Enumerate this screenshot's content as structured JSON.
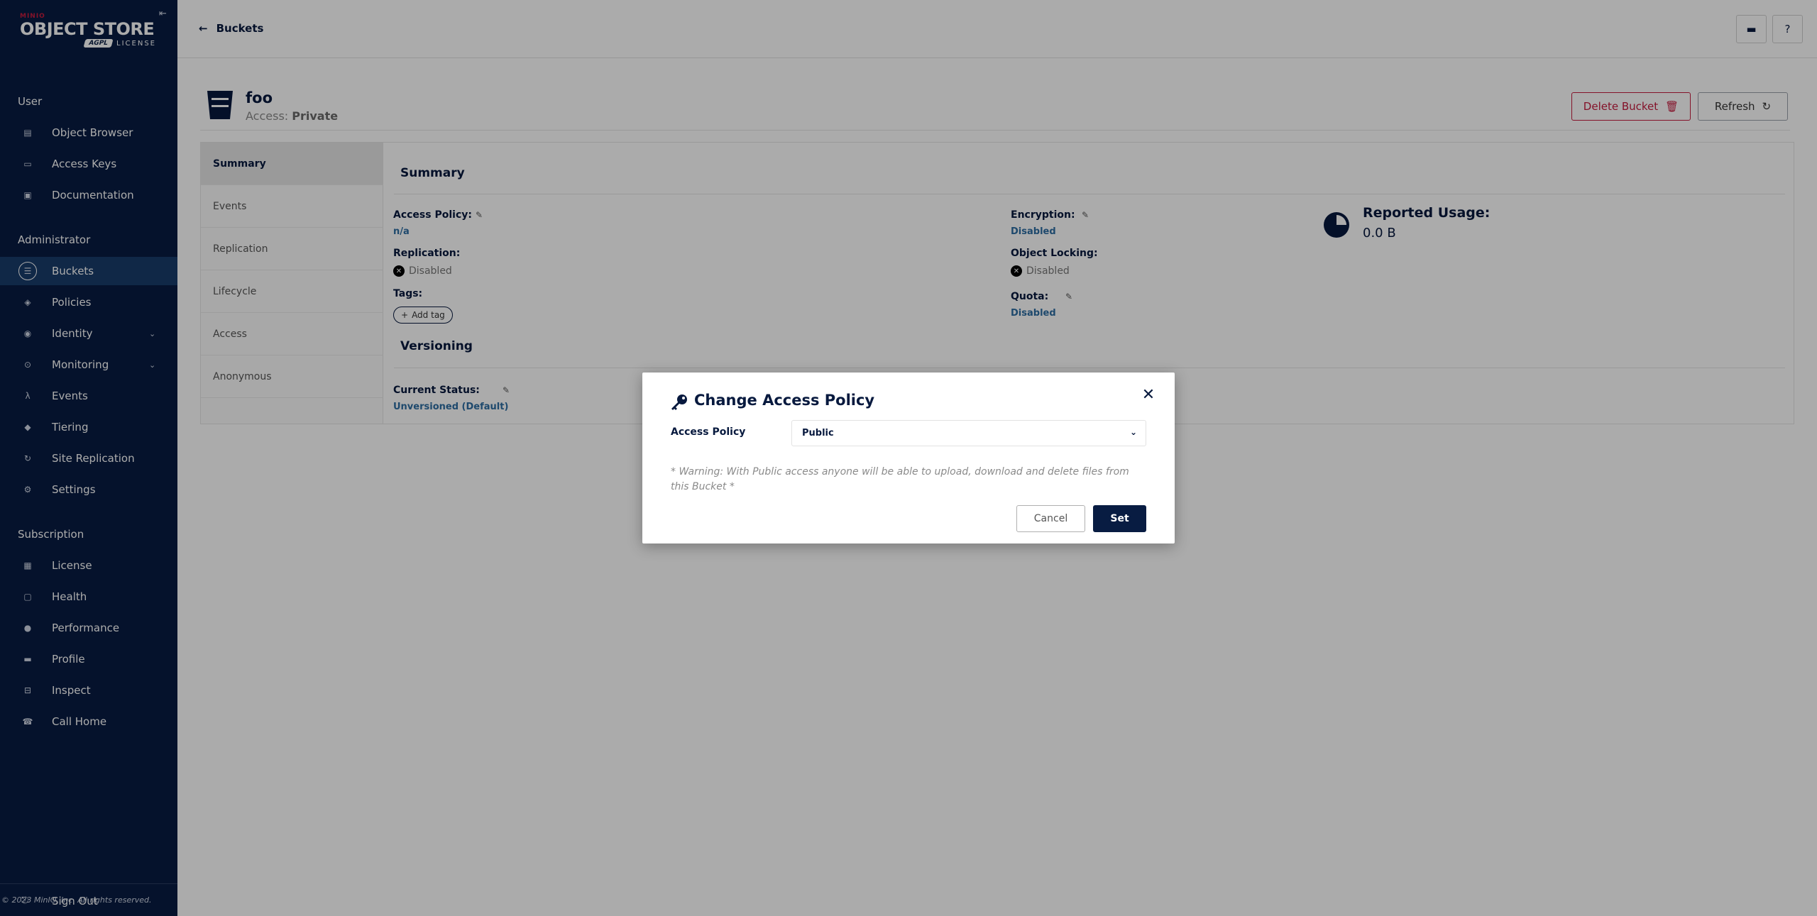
{
  "sidebar": {
    "logo": {
      "brand": "MINIO",
      "product": "OBJECT STORE",
      "badge": "AGPL",
      "license": "LICENSE"
    },
    "sections": {
      "user": "User",
      "administrator": "Administrator",
      "subscription": "Subscription"
    },
    "user_items": [
      {
        "label": "Object Browser",
        "icon": "object-browser-icon"
      },
      {
        "label": "Access Keys",
        "icon": "access-keys-icon"
      },
      {
        "label": "Documentation",
        "icon": "documentation-icon"
      }
    ],
    "admin_items": [
      {
        "label": "Buckets",
        "icon": "buckets-icon",
        "active": true
      },
      {
        "label": "Policies",
        "icon": "policies-icon"
      },
      {
        "label": "Identity",
        "icon": "identity-icon",
        "expandable": true
      },
      {
        "label": "Monitoring",
        "icon": "monitoring-icon",
        "expandable": true
      },
      {
        "label": "Events",
        "icon": "lambda-icon"
      },
      {
        "label": "Tiering",
        "icon": "tiering-icon"
      },
      {
        "label": "Site Replication",
        "icon": "site-replication-icon"
      },
      {
        "label": "Settings",
        "icon": "gear-icon"
      }
    ],
    "subscription_items": [
      {
        "label": "License",
        "icon": "license-icon"
      },
      {
        "label": "Health",
        "icon": "health-icon"
      },
      {
        "label": "Performance",
        "icon": "performance-icon"
      },
      {
        "label": "Profile",
        "icon": "profile-icon"
      },
      {
        "label": "Inspect",
        "icon": "inspect-icon"
      },
      {
        "label": "Call Home",
        "icon": "phone-icon"
      }
    ],
    "sign_out": "Sign Out",
    "copyright": "© 2023 MinIO, Inc. All rights reserved."
  },
  "topbar": {
    "back_label": "Buckets"
  },
  "bucket": {
    "name": "foo",
    "access_prefix": "Access:",
    "access_value": "Private",
    "delete_label": "Delete Bucket",
    "refresh_label": "Refresh"
  },
  "tabs": [
    "Summary",
    "Events",
    "Replication",
    "Lifecycle",
    "Access",
    "Anonymous"
  ],
  "summary": {
    "title": "Summary",
    "access_policy_label": "Access Policy:",
    "access_policy_value": "n/a",
    "replication_label": "Replication:",
    "replication_value": "Disabled",
    "tags_label": "Tags:",
    "add_tag_label": "Add tag",
    "encryption_label": "Encryption:",
    "encryption_value": "Disabled",
    "object_locking_label": "Object Locking:",
    "object_locking_value": "Disabled",
    "quota_label": "Quota:",
    "quota_value": "Disabled",
    "usage_label": "Reported Usage:",
    "usage_value": "0.0 B"
  },
  "versioning": {
    "title": "Versioning",
    "status_label": "Current Status:",
    "status_value": "Unversioned (Default)"
  },
  "modal": {
    "title": "Change Access Policy",
    "field_label": "Access Policy",
    "selected": "Public",
    "warning": "* Warning: With Public access anyone will be able to upload, download and delete files from this Bucket *",
    "cancel_label": "Cancel",
    "set_label": "Set"
  },
  "colors": {
    "sidebar_bg": "#081c42",
    "accent_danger": "#c51b3e",
    "link": "#2e6ea3"
  }
}
